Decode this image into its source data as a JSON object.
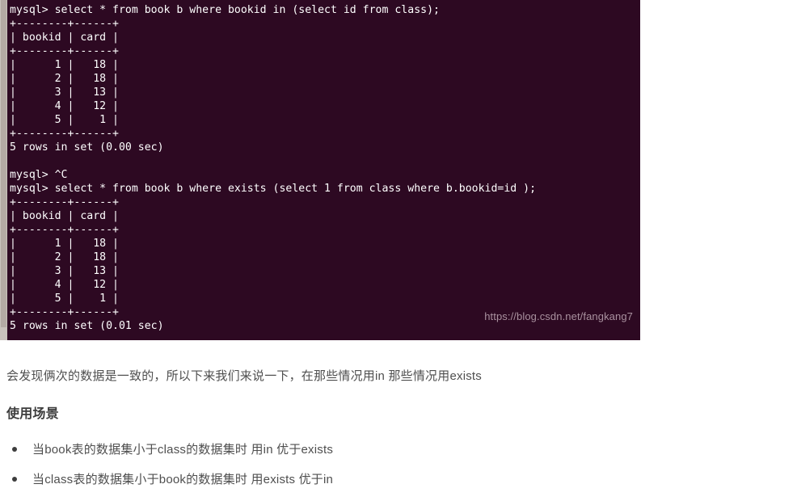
{
  "terminal": {
    "background_color": "#2d0922",
    "text_color": "#ffffff",
    "watermark": "https://blog.csdn.net/fangkang7",
    "watermark_color": "#a9919f",
    "lines": [
      "mysql> select * from book b where bookid in (select id from class);",
      "+--------+------+",
      "| bookid | card |",
      "+--------+------+",
      "|      1 |   18 |",
      "|      2 |   18 |",
      "|      3 |   13 |",
      "|      4 |   12 |",
      "|      5 |    1 |",
      "+--------+------+",
      "5 rows in set (0.00 sec)",
      "",
      "mysql> ^C",
      "mysql> select * from book b where exists (select 1 from class where b.bookid=id );",
      "+--------+------+",
      "| bookid | card |",
      "+--------+------+",
      "|      1 |   18 |",
      "|      2 |   18 |",
      "|      3 |   13 |",
      "|      4 |   12 |",
      "|      5 |    1 |",
      "+--------+------+",
      "5 rows in set (0.01 sec)"
    ]
  },
  "article": {
    "paragraph": "会发现俩次的数据是一致的，所以下来我们来说一下，在那些情况用in 那些情况用exists",
    "heading": "使用场景",
    "bullets": [
      "当book表的数据集小于class的数据集时 用in 优于exists",
      "当class表的数据集小于book的数据集时 用exists 优于in"
    ]
  }
}
